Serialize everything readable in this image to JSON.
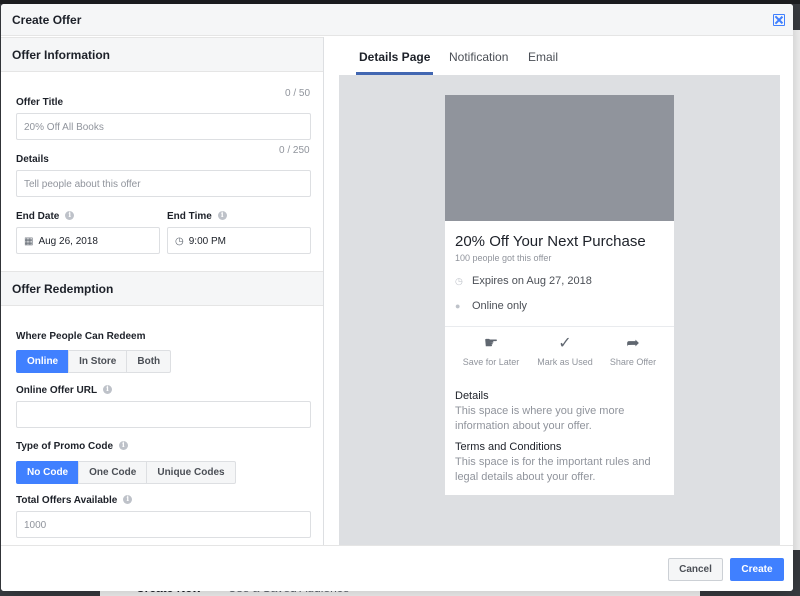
{
  "modal": {
    "title": "Create Offer",
    "close_icon": "close-icon"
  },
  "offer_information": {
    "heading": "Offer Information",
    "title_label": "Offer Title",
    "title_counter": "0 / 50",
    "title_placeholder": "20% Off All Books",
    "details_label": "Details",
    "details_counter": "0 / 250",
    "details_placeholder": "Tell people about this offer",
    "end_date_label": "End Date",
    "end_date_value": "Aug 26, 2018",
    "end_time_label": "End Time",
    "end_time_value": "9:00 PM"
  },
  "offer_redemption": {
    "heading": "Offer Redemption",
    "where_label": "Where People Can Redeem",
    "where_options": [
      "Online",
      "In Store",
      "Both"
    ],
    "where_selected": "Online",
    "url_label": "Online Offer URL",
    "url_value": "",
    "promo_label": "Type of Promo Code",
    "promo_options": [
      "No Code",
      "One Code",
      "Unique Codes"
    ],
    "promo_selected": "No Code",
    "total_label": "Total Offers Available",
    "total_placeholder": "1000"
  },
  "tabs": {
    "items": [
      "Details Page",
      "Notification",
      "Email"
    ],
    "active": "Details Page"
  },
  "preview": {
    "title": "20% Off Your Next Purchase",
    "subtitle": "100 people got this offer",
    "expires": "Expires on Aug 27, 2018",
    "availability": "Online only",
    "actions": [
      "Save for Later",
      "Mark as Used",
      "Share Offer"
    ],
    "details_heading": "Details",
    "details_text": "This space is where you give more information about your offer.",
    "terms_heading": "Terms and Conditions",
    "terms_text": "This space is for the important rules and legal details about your offer."
  },
  "footer": {
    "cancel_label": "Cancel",
    "create_label": "Create"
  },
  "background": {
    "primary_text": "Create New",
    "secondary_text": "Use a Saved Audience"
  },
  "colors": {
    "accent": "#4080ff",
    "tab_underline": "#4267b2",
    "preview_bg": "#dddfe2",
    "image_placeholder": "#90949c"
  }
}
